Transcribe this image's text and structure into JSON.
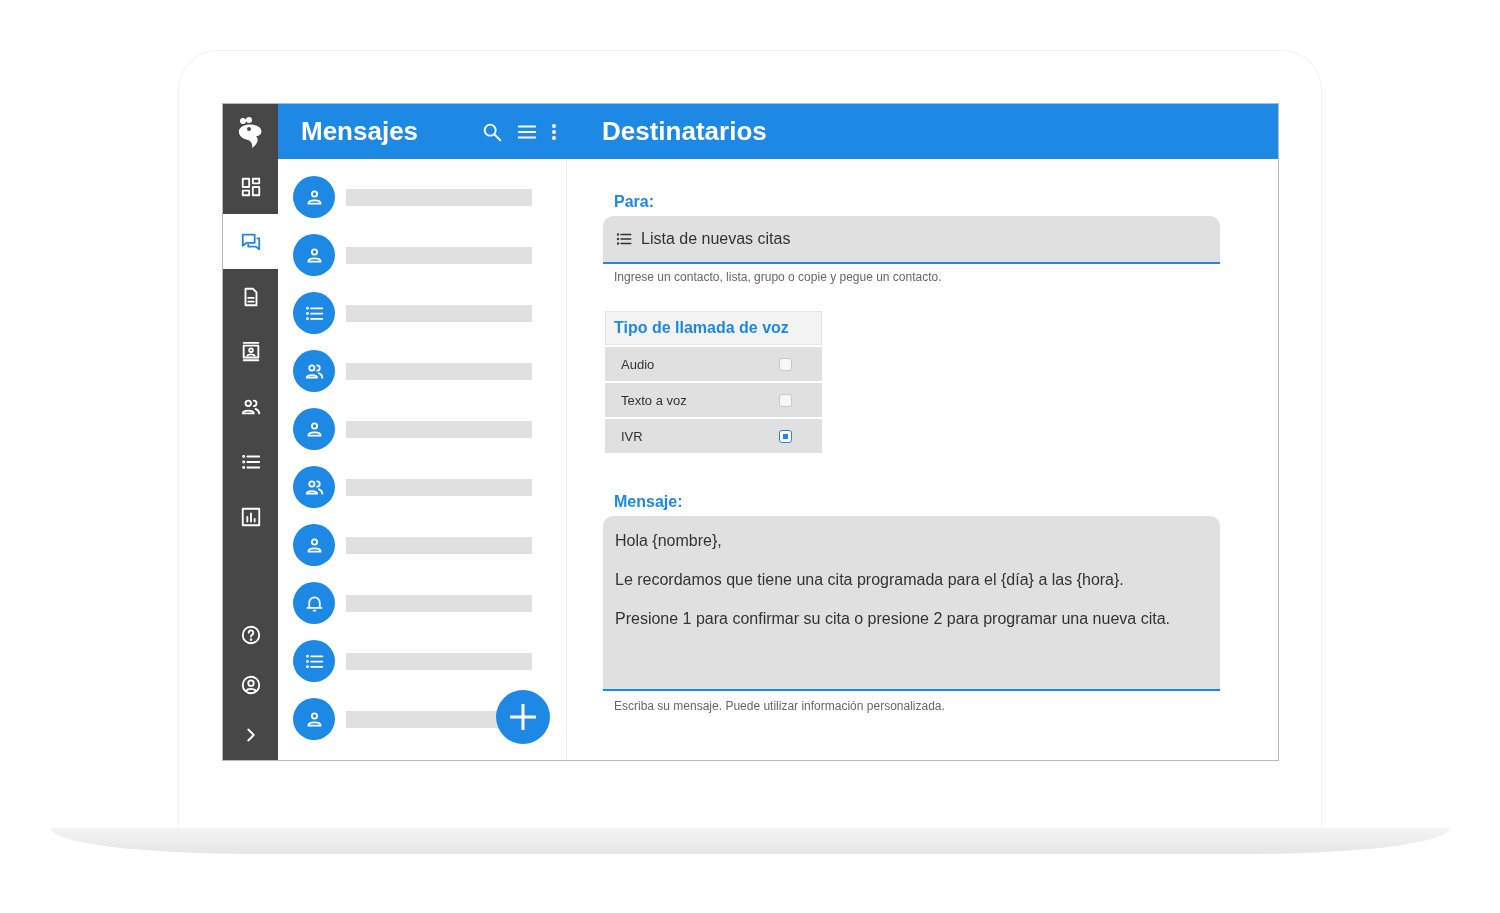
{
  "rail": {
    "items": [
      {
        "kind": "dashboard",
        "selected": false
      },
      {
        "kind": "messages",
        "selected": true
      },
      {
        "kind": "document",
        "selected": false
      },
      {
        "kind": "contact-card",
        "selected": false
      },
      {
        "kind": "groups",
        "selected": false
      },
      {
        "kind": "list",
        "selected": false
      },
      {
        "kind": "chart",
        "selected": false
      },
      {
        "kind": "help",
        "selected": false
      },
      {
        "kind": "account",
        "selected": false
      },
      {
        "kind": "expand",
        "selected": false
      }
    ]
  },
  "messages_panel": {
    "title": "Mensajes",
    "items": [
      {
        "kind": "person"
      },
      {
        "kind": "person"
      },
      {
        "kind": "list"
      },
      {
        "kind": "group"
      },
      {
        "kind": "person"
      },
      {
        "kind": "group"
      },
      {
        "kind": "person"
      },
      {
        "kind": "bell"
      },
      {
        "kind": "list"
      },
      {
        "kind": "person"
      }
    ]
  },
  "recipients": {
    "title": "Destinatarios",
    "to": {
      "label": "Para:",
      "value": "Lista de nuevas citas",
      "hint": "Ingrese un contacto, lista, grupo o copie y pegue un contacto."
    },
    "call_type": {
      "title": "Tipo de llamada de voz",
      "options": [
        {
          "label": "Audio",
          "checked": false
        },
        {
          "label": "Texto a voz",
          "checked": false
        },
        {
          "label": "IVR",
          "checked": true
        }
      ]
    },
    "message": {
      "label": "Mensaje:",
      "paragraphs": [
        "Hola {nombre},",
        "Le recordamos que tiene una cita programada para el {día} a las {hora}.",
        "Presione 1 para confirmar su cita o presione 2 para programar una nueva cita."
      ],
      "hint": "Escriba su mensaje. Puede utilizar información personalizada."
    }
  }
}
